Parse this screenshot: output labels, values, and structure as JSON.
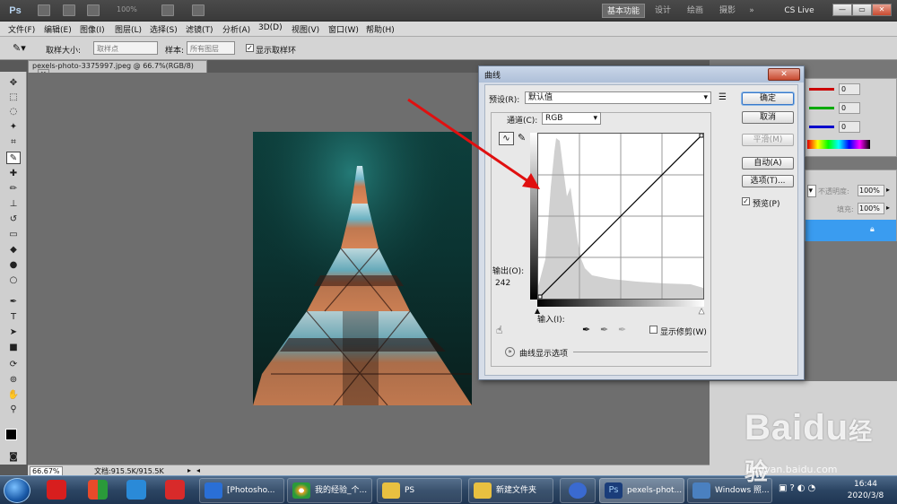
{
  "app": {
    "logo": "Ps",
    "zoom": "100%",
    "workspaces": [
      "基本功能",
      "设计",
      "绘画",
      "摄影"
    ],
    "more": "»",
    "cslive": "CS Live",
    "win_controls": [
      "—",
      "▭",
      "✕"
    ]
  },
  "menu": [
    "文件(F)",
    "编辑(E)",
    "图像(I)",
    "图层(L)",
    "选择(S)",
    "滤镜(T)",
    "分析(A)",
    "3D(D)",
    "视图(V)",
    "窗口(W)",
    "帮助(H)"
  ],
  "options": {
    "sample_size_label": "取样大小:",
    "sample_size_value": "取样点",
    "sample_label": "样本:",
    "sample_value": "所有图层",
    "show_ring_label": "显示取样环",
    "show_ring_checked": true
  },
  "document": {
    "tab_title": "pexels-photo-3375997.jpeg @ 66.7%(RGB/8)",
    "tab_close": "✕"
  },
  "status": {
    "zoom": "66.67%",
    "doc_info": "文档:915.5K/915.5K"
  },
  "panels": {
    "color_values": [
      "0",
      "0",
      "0"
    ],
    "opacity_label": "不透明度:",
    "opacity_value": "100%",
    "fill_label": "填充:",
    "fill_value": "100%"
  },
  "curves": {
    "title": "曲线",
    "close": "✕",
    "preset_label": "预设(R):",
    "preset_value": "默认值",
    "channel_label": "通道(C):",
    "channel_value": "RGB",
    "output_label": "输出(O):",
    "output_value": "242",
    "input_label": "输入(I):",
    "show_clipping_label": "显示修剪(W)",
    "display_options_label": "曲线显示选项",
    "buttons": {
      "ok": "确定",
      "cancel": "取消",
      "smooth": "平滑(M)",
      "auto": "自动(A)",
      "options": "选项(T)..."
    },
    "preview_label": "预览(P)",
    "preview_checked": true
  },
  "taskbar": {
    "items": [
      {
        "label": "[Photosho...",
        "color": "#2a6fd6"
      },
      {
        "label": "我的经验_个...",
        "color": "#e8a020"
      },
      {
        "label": "PS",
        "color": "#e8c040"
      },
      {
        "label": "新建文件夹",
        "color": "#e8c040"
      },
      {
        "label": "",
        "color": "#3a6ad0"
      },
      {
        "label": "pexels-phot...",
        "color": "#1a3d7a"
      },
      {
        "label": "Windows 照...",
        "color": "#4a80c0"
      }
    ],
    "clock_time": "16:44",
    "clock_date": "2020/3/8"
  },
  "watermark": {
    "brand": "Baidu",
    "brand_cn": "经验",
    "url": "jingyan.baidu.com"
  },
  "colors": {
    "accent_blue": "#3a9cf0",
    "arrow_red": "#e01010"
  }
}
